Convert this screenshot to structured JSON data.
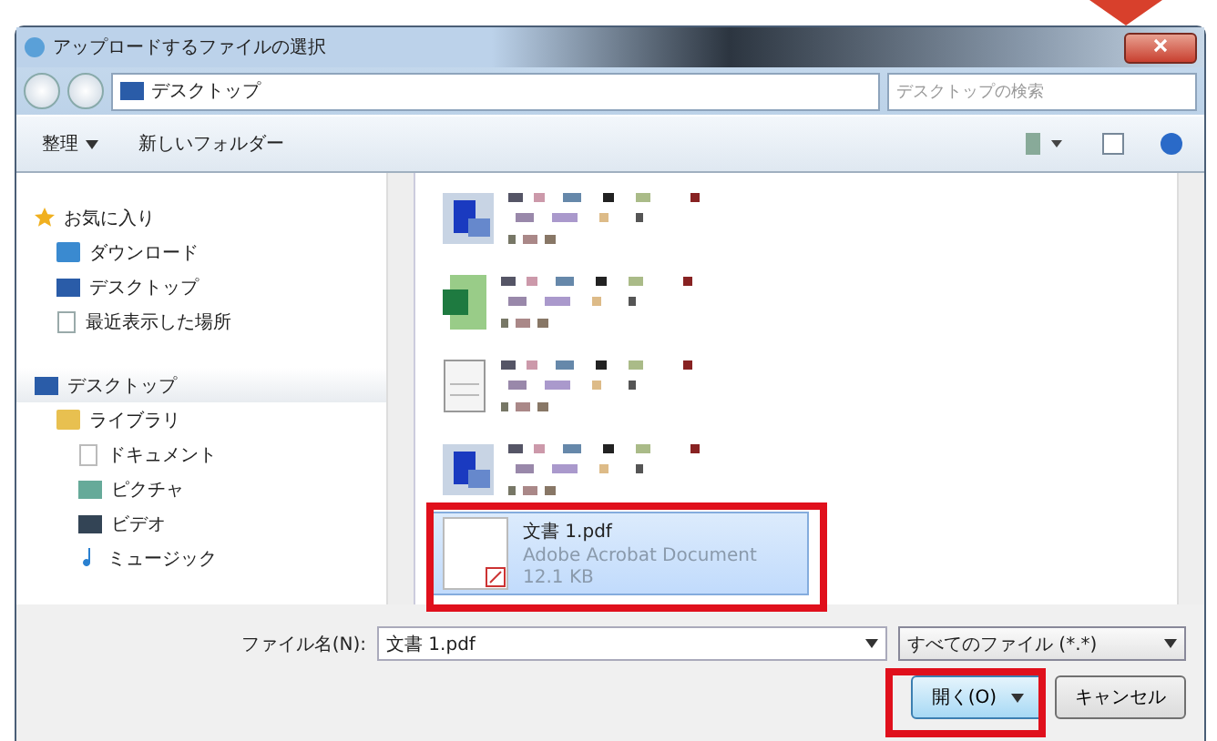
{
  "window": {
    "title": "アップロードするファイルの選択"
  },
  "address": {
    "location": "デスクトップ",
    "search_placeholder": "デスクトップの検索"
  },
  "toolbar": {
    "organize": "整理",
    "new_folder": "新しいフォルダー"
  },
  "sidebar": {
    "groups": [
      {
        "label": "お気に入り",
        "kind": "favorites",
        "items": [
          {
            "label": "ダウンロード",
            "kind": "download"
          },
          {
            "label": "デスクトップ",
            "kind": "desktop"
          },
          {
            "label": "最近表示した場所",
            "kind": "recent"
          }
        ]
      },
      {
        "label": "デスクトップ",
        "kind": "desktop",
        "items": [
          {
            "label": "ライブラリ",
            "kind": "library",
            "children": [
              {
                "label": "ドキュメント",
                "kind": "document"
              },
              {
                "label": "ピクチャ",
                "kind": "picture"
              },
              {
                "label": "ビデオ",
                "kind": "video"
              },
              {
                "label": "ミュージック",
                "kind": "music"
              }
            ]
          }
        ]
      }
    ]
  },
  "files": [
    {
      "kind": "redacted",
      "selected": false
    },
    {
      "kind": "redacted",
      "selected": false
    },
    {
      "kind": "redacted",
      "selected": false
    },
    {
      "kind": "redacted",
      "selected": false
    },
    {
      "kind": "file",
      "name": "文書 1.pdf",
      "type": "Adobe Acrobat Document",
      "size": "12.1 KB",
      "selected": true
    }
  ],
  "footer": {
    "filename_label": "ファイル名(N):",
    "filename": "文書 1.pdf",
    "filetype": "すべてのファイル (*.*)",
    "open": "開く(O)",
    "cancel": "キャンセル"
  }
}
